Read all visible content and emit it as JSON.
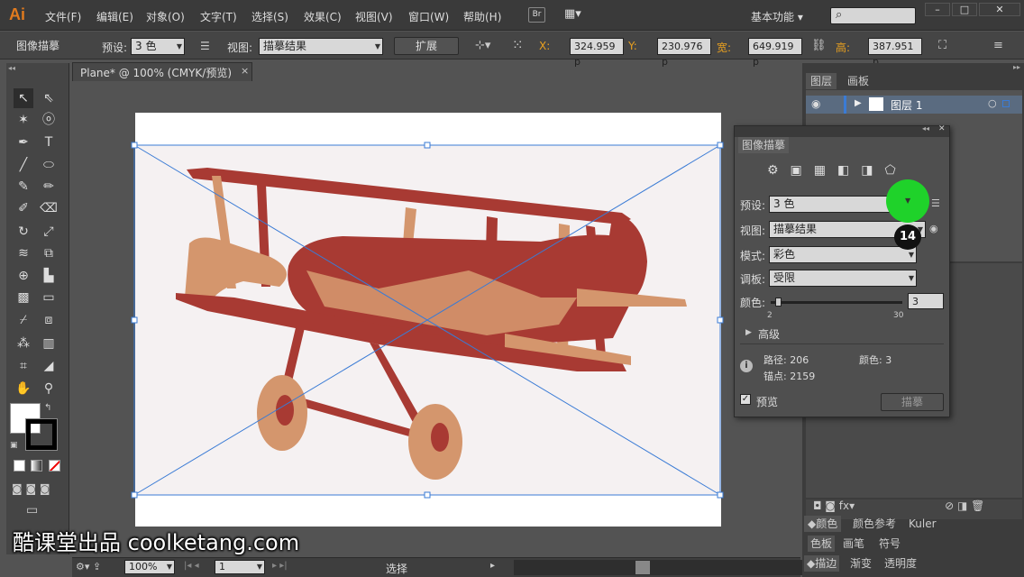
{
  "app": {
    "logo": "Ai",
    "workspace": "基本功能"
  },
  "menu": [
    "文件(F)",
    "编辑(E)",
    "对象(O)",
    "文字(T)",
    "选择(S)",
    "效果(C)",
    "视图(V)",
    "窗口(W)",
    "帮助(H)"
  ],
  "bridge": "Br",
  "ctrl": {
    "title": "图像描摹",
    "preset_label": "预设:",
    "preset_value": "3 色",
    "view_label": "视图:",
    "view_value": "描摹结果",
    "expand": "扩展",
    "x_label": "X:",
    "x_val": "324.959 p",
    "y_label": "Y:",
    "y_val": "230.976 p",
    "w_label": "宽:",
    "w_val": "649.919 p",
    "h_label": "高:",
    "h_val": "387.951 p"
  },
  "doc": {
    "tab": "Plane* @ 100% (CMYK/预览)"
  },
  "status": {
    "zoom": "100%",
    "page": "1",
    "tool": "选择"
  },
  "right": {
    "tab1": "图层",
    "tab2": "画板",
    "layer_name": "图层 1",
    "tab_color": "颜色",
    "tab_colorguide": "颜色参考",
    "tab_kuler": "Kuler",
    "tab_swatch": "色板",
    "tab_brush": "画笔",
    "tab_symbol": "符号",
    "tab_stroke": "描边",
    "tab_gradient": "渐变",
    "tab_transparency": "透明度"
  },
  "trace": {
    "title": "图像描摹",
    "preset_label": "预设:",
    "preset_value": "3 色",
    "view_label": "视图:",
    "view_value": "描摹结果",
    "mode_label": "模式:",
    "mode_value": "彩色",
    "palette_label": "调板:",
    "palette_value": "受限",
    "colors_label": "颜色:",
    "colors_value": "3",
    "slider_min": "2",
    "slider_max": "30",
    "slider_level": 0.036,
    "advanced": "高级",
    "paths_label": "路径: 206",
    "colors_info": "颜色: 3",
    "anchors_label": "锚点: 2159",
    "preview": "预览",
    "trace_button": "描摹"
  },
  "step_badge": "14",
  "watermark": "酷课堂出品 coolketang.com",
  "colors": {
    "plane_dark": "#a83a33",
    "plane_light": "#d4966d",
    "accent": "#1fd22a"
  }
}
